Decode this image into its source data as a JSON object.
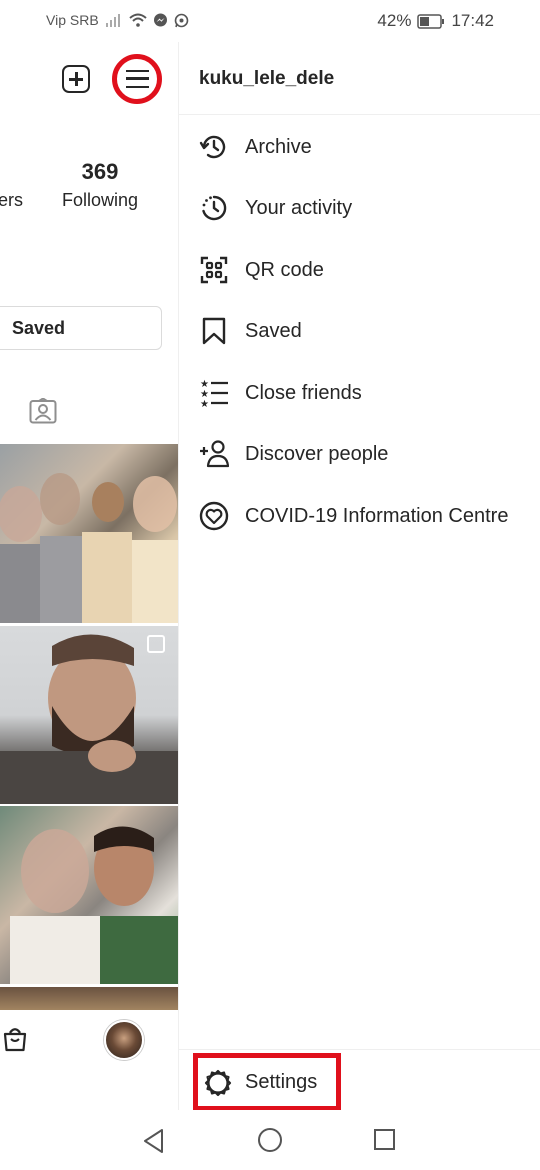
{
  "status_bar": {
    "carrier": "Vip SRB",
    "battery": "42%",
    "time": "17:42"
  },
  "profile": {
    "followers_partial": "ers",
    "following_count": "369",
    "following_label": "Following",
    "saved_button": "Saved"
  },
  "drawer": {
    "username": "kuku_lele_dele",
    "items": [
      {
        "label": "Archive",
        "icon": "archive-icon"
      },
      {
        "label": "Your activity",
        "icon": "activity-icon"
      },
      {
        "label": "QR code",
        "icon": "qr-code-icon"
      },
      {
        "label": "Saved",
        "icon": "bookmark-icon"
      },
      {
        "label": "Close friends",
        "icon": "close-friends-list-icon"
      },
      {
        "label": "Discover people",
        "icon": "add-person-icon"
      },
      {
        "label": "COVID-19 Information Centre",
        "icon": "heart-badge-icon"
      }
    ],
    "settings": "Settings"
  },
  "colors": {
    "highlight": "#e0101c",
    "text": "#262626",
    "divider": "#efefef"
  }
}
